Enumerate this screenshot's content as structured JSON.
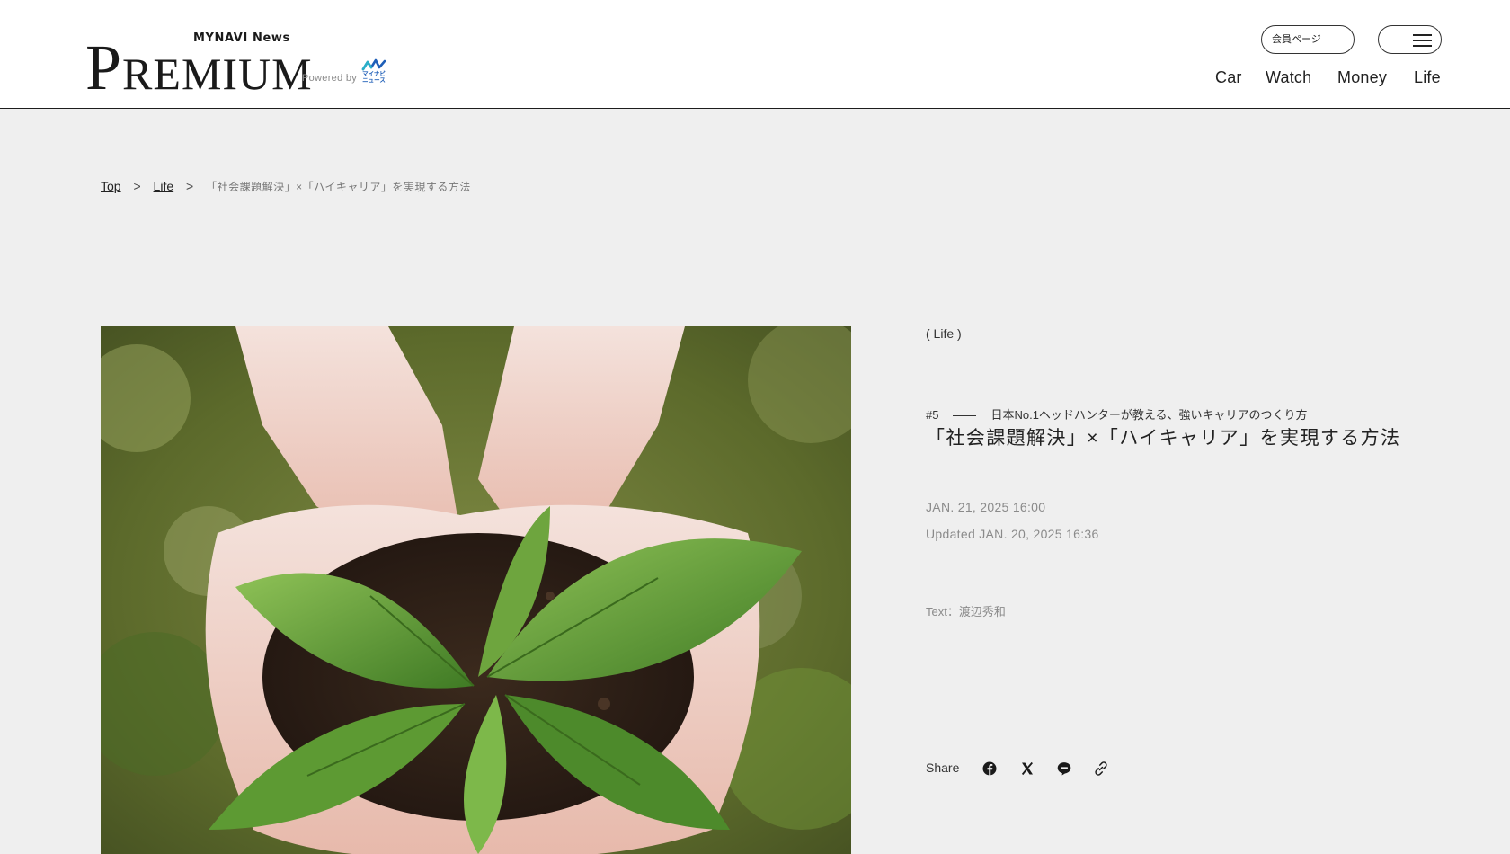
{
  "header": {
    "logo": {
      "supertitle": "MYNAVI News",
      "wordmark_initial": "P",
      "wordmark_rest": "REMIUM",
      "powered_by": "Powered by",
      "badge_text": "マイナビ ニュース"
    },
    "member_button": "会員ページ",
    "menu_icon": "hamburger-icon",
    "nav": [
      {
        "label": "Car"
      },
      {
        "label": "Watch"
      },
      {
        "label": "Money"
      },
      {
        "label": "Life"
      }
    ]
  },
  "breadcrumb": {
    "items": [
      {
        "label": "Top"
      },
      {
        "label": "Life"
      }
    ],
    "separator": ">",
    "current": "「社会課題解決」×「ハイキャリア」を実現する方法"
  },
  "hero": {
    "image_icon": "plant-seedling-in-hands-image"
  },
  "article": {
    "category": "( Life )",
    "series_number": "#5",
    "series_title": "日本No.1ヘッドハンターが教える、強いキャリアのつくり方",
    "title": "「社会課題解決」×「ハイキャリア」を実現する方法",
    "date": "JAN. 21, 2025 16:00",
    "updated": "Updated JAN. 20, 2025 16:36",
    "author": "Text：渡辺秀和"
  },
  "share": {
    "label": "Share",
    "icons": [
      "facebook-icon",
      "x-icon",
      "line-icon",
      "link-icon"
    ]
  },
  "colors": {
    "page_background": "#efefef",
    "header_background": "#ffffff",
    "text": "#222222",
    "muted_text": "#8a8a8a",
    "badge_blue": "#1f5fb8"
  }
}
